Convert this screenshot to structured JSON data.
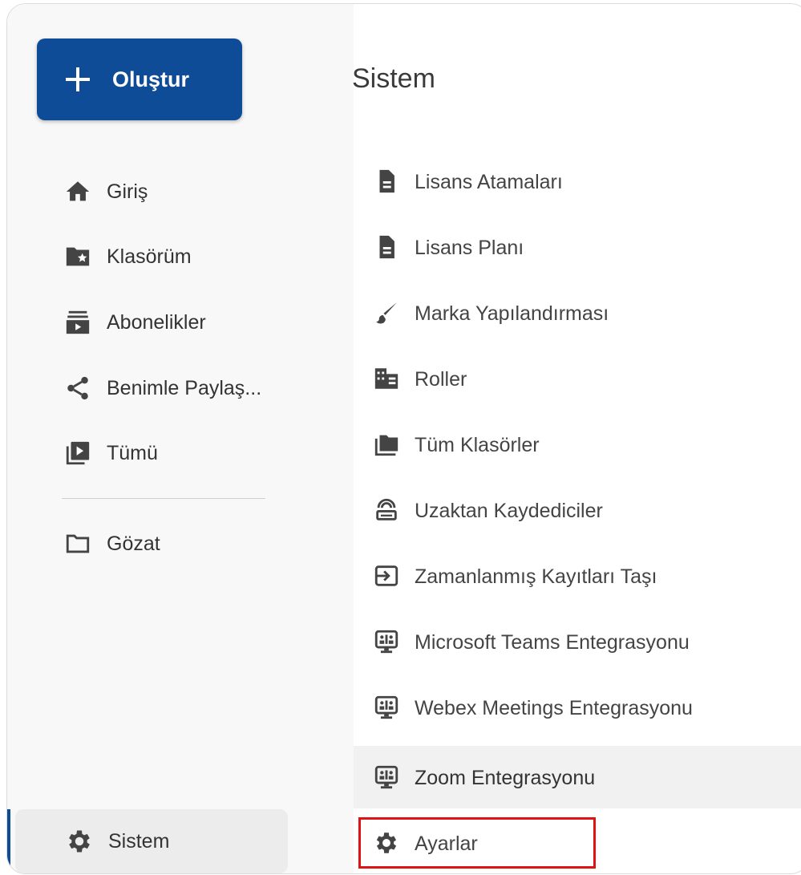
{
  "sidebar": {
    "create_label": "Oluştur",
    "items": [
      {
        "label": "Giriş",
        "icon": "home-icon"
      },
      {
        "label": "Klasörüm",
        "icon": "folder-star-icon"
      },
      {
        "label": "Abonelikler",
        "icon": "subscriptions-icon"
      },
      {
        "label": "Benimle Paylaş...",
        "icon": "share-icon"
      },
      {
        "label": "Tümü",
        "icon": "video-library-icon"
      },
      {
        "label": "Gözat",
        "icon": "folder-outline-icon"
      }
    ],
    "active_item": {
      "label": "Sistem",
      "icon": "gear-icon"
    }
  },
  "content": {
    "title": "Sistem",
    "items": [
      {
        "label": "Lisans Atamaları",
        "icon": "document-icon"
      },
      {
        "label": "Lisans Planı",
        "icon": "document-icon"
      },
      {
        "label": "Marka Yapılandırması",
        "icon": "brush-icon"
      },
      {
        "label": "Roller",
        "icon": "roles-icon"
      },
      {
        "label": "Tüm Klasörler",
        "icon": "folder-icon"
      },
      {
        "label": "Uzaktan Kaydediciler",
        "icon": "router-icon"
      },
      {
        "label": "Zamanlanmış Kayıtları Taşı",
        "icon": "move-icon"
      },
      {
        "label": "Microsoft Teams Entegrasyonu",
        "icon": "integration-icon"
      },
      {
        "label": "Webex Meetings Entegrasyonu",
        "icon": "integration-icon"
      },
      {
        "label": "Zoom Entegrasyonu",
        "icon": "integration-icon"
      },
      {
        "label": "Ayarlar",
        "icon": "gear-icon"
      }
    ]
  },
  "colors": {
    "accent": "#0f4c97",
    "highlight_border": "#e01313"
  }
}
